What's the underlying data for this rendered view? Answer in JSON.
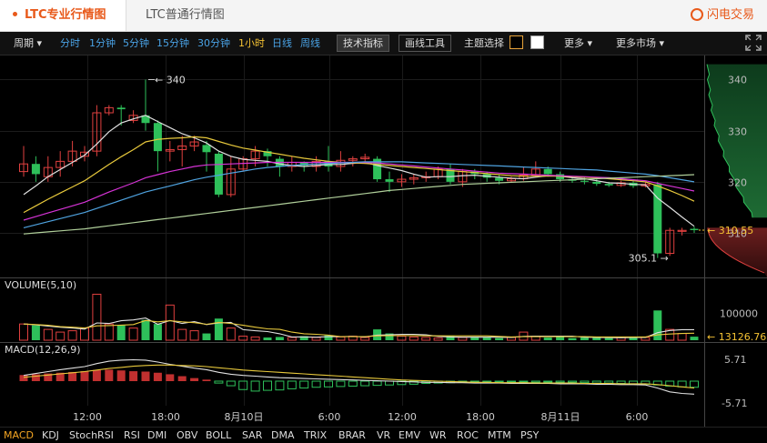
{
  "tabs": {
    "pro": "LTC专业行情图",
    "normal": "LTC普通行情图"
  },
  "brand": {
    "name": "闪电交易",
    "icon": "lightning-logo-icon"
  },
  "toolbar": {
    "period": "周期",
    "intervals": [
      "分时",
      "1分钟",
      "5分钟",
      "15分钟",
      "30分钟",
      "1小时",
      "日线",
      "周线"
    ],
    "active_interval": "1小时",
    "indicators_btn": "技术指标",
    "draw_tools_btn": "画线工具",
    "theme_label": "主题选择",
    "theme_colors": [
      "#000000",
      "#ffffff"
    ],
    "more": "更多",
    "more_markets": "更多市场",
    "fullscreen_icon": "fullscreen-icon"
  },
  "chart_data": [
    {
      "type": "candlestick",
      "panel": "price",
      "price_axis_ticks": [
        340,
        330,
        320,
        310
      ],
      "ylim": [
        302,
        344
      ],
      "last_price_label": "310.55",
      "last_price": 310.55,
      "max_annotation": "340",
      "max_price": 340,
      "min_annotation": "305.1",
      "min_price": 305.1,
      "x_labels": [
        "12:00",
        "18:00",
        "8月10日",
        "6:00",
        "12:00",
        "18:00",
        "8月11日",
        "6:00"
      ],
      "candles": [
        {
          "o": 322,
          "c": 323.5,
          "h": 327,
          "l": 321
        },
        {
          "o": 323.5,
          "c": 321.5,
          "h": 325,
          "l": 320
        },
        {
          "o": 321,
          "c": 322.8,
          "h": 325,
          "l": 320
        },
        {
          "o": 322.8,
          "c": 324,
          "h": 326,
          "l": 321
        },
        {
          "o": 324,
          "c": 326,
          "h": 328,
          "l": 323
        },
        {
          "o": 325,
          "c": 325.8,
          "h": 327,
          "l": 324
        },
        {
          "o": 326,
          "c": 333.5,
          "h": 335,
          "l": 325
        },
        {
          "o": 333.5,
          "c": 334.5,
          "h": 335,
          "l": 333
        },
        {
          "o": 334.5,
          "c": 334.2,
          "h": 335,
          "l": 331
        },
        {
          "o": 332,
          "c": 333,
          "h": 334,
          "l": 331.5
        },
        {
          "o": 333,
          "c": 331.5,
          "h": 340,
          "l": 330
        },
        {
          "o": 331.5,
          "c": 326,
          "h": 332,
          "l": 322
        },
        {
          "o": 326,
          "c": 326.3,
          "h": 328,
          "l": 324
        },
        {
          "o": 326.3,
          "c": 327,
          "h": 329,
          "l": 323
        },
        {
          "o": 327,
          "c": 327.8,
          "h": 329,
          "l": 326
        },
        {
          "o": 327.2,
          "c": 325.8,
          "h": 328,
          "l": 322
        },
        {
          "o": 325.5,
          "c": 317.5,
          "h": 326,
          "l": 317
        },
        {
          "o": 317.5,
          "c": 322.5,
          "h": 325,
          "l": 317
        },
        {
          "o": 322.5,
          "c": 324.5,
          "h": 325,
          "l": 322
        },
        {
          "o": 324.5,
          "c": 326,
          "h": 327,
          "l": 323
        },
        {
          "o": 326,
          "c": 325,
          "h": 326.5,
          "l": 323
        },
        {
          "o": 324.5,
          "c": 323,
          "h": 325,
          "l": 321
        },
        {
          "o": 323,
          "c": 323.8,
          "h": 325,
          "l": 322
        },
        {
          "o": 323.8,
          "c": 323.2,
          "h": 324,
          "l": 322
        },
        {
          "o": 323,
          "c": 324,
          "h": 325,
          "l": 322
        },
        {
          "o": 324,
          "c": 323,
          "h": 327,
          "l": 322
        },
        {
          "o": 323,
          "c": 324.2,
          "h": 326,
          "l": 322
        },
        {
          "o": 324.2,
          "c": 324.5,
          "h": 325,
          "l": 323
        },
        {
          "o": 324.5,
          "c": 324.8,
          "h": 325.5,
          "l": 323.5
        },
        {
          "o": 324.5,
          "c": 320.5,
          "h": 325,
          "l": 320
        },
        {
          "o": 320.5,
          "c": 320,
          "h": 322,
          "l": 318
        },
        {
          "o": 320,
          "c": 320.5,
          "h": 321.5,
          "l": 319
        },
        {
          "o": 320.5,
          "c": 320.8,
          "h": 321.5,
          "l": 319.5
        },
        {
          "o": 320.8,
          "c": 321,
          "h": 322,
          "l": 320
        },
        {
          "o": 321,
          "c": 322.5,
          "h": 323,
          "l": 320.5
        },
        {
          "o": 322.5,
          "c": 320,
          "h": 323.5,
          "l": 319.5
        },
        {
          "o": 320,
          "c": 322,
          "h": 322.5,
          "l": 319
        },
        {
          "o": 322,
          "c": 321.5,
          "h": 322.5,
          "l": 320.5
        },
        {
          "o": 321.5,
          "c": 320.8,
          "h": 322,
          "l": 320
        },
        {
          "o": 320.8,
          "c": 320.2,
          "h": 321.5,
          "l": 319.5
        },
        {
          "o": 320.2,
          "c": 320.6,
          "h": 321,
          "l": 319.8
        },
        {
          "o": 320.6,
          "c": 321.3,
          "h": 323,
          "l": 320.2
        },
        {
          "o": 321.3,
          "c": 322.5,
          "h": 324,
          "l": 321
        },
        {
          "o": 322.5,
          "c": 321.5,
          "h": 323,
          "l": 321
        },
        {
          "o": 321.5,
          "c": 320.5,
          "h": 322,
          "l": 320
        },
        {
          "o": 320.5,
          "c": 320.2,
          "h": 321,
          "l": 319.8
        },
        {
          "o": 320.2,
          "c": 320,
          "h": 320.8,
          "l": 319.5
        },
        {
          "o": 320,
          "c": 319.6,
          "h": 320.5,
          "l": 319.2
        },
        {
          "o": 319.6,
          "c": 319.3,
          "h": 320,
          "l": 319
        },
        {
          "o": 319.3,
          "c": 319.8,
          "h": 320.2,
          "l": 319
        },
        {
          "o": 319.8,
          "c": 319.2,
          "h": 320.3,
          "l": 318.8
        },
        {
          "o": 319.2,
          "c": 319.5,
          "h": 320,
          "l": 318.9
        },
        {
          "o": 319.5,
          "c": 306,
          "h": 320,
          "l": 305.1
        },
        {
          "o": 306,
          "c": 310.5,
          "h": 311,
          "l": 305.5
        },
        {
          "o": 310.3,
          "c": 310.5,
          "h": 311,
          "l": 309.5
        },
        {
          "o": 310.8,
          "c": 310.55,
          "h": 311.2,
          "l": 310
        }
      ],
      "ma_series": [
        {
          "color": "#e0e0e0",
          "values": [
            317.5,
            319.2,
            321,
            322.4,
            323.8,
            325.2,
            327.4,
            329.8,
            331.5,
            332.3,
            333,
            331.8,
            330.6,
            329.4,
            328.6,
            327.6,
            326,
            325,
            324.4,
            324.2,
            324,
            323.5,
            323.2,
            323,
            323.2,
            323.4,
            323.4,
            323.6,
            323.8,
            323.2,
            322.7,
            322.2,
            321.5,
            320.9,
            321,
            321,
            321.2,
            321.3,
            321.1,
            320.9,
            320.7,
            320.6,
            320.9,
            321.2,
            321.1,
            320.8,
            320.6,
            320.2,
            319.8,
            319.7,
            319.5,
            319.4,
            316.8,
            315,
            313.1,
            311.3
          ]
        },
        {
          "color": "#e8c93c",
          "values": [
            314,
            315.3,
            316.6,
            317.8,
            319,
            320.2,
            321.8,
            323.4,
            324.9,
            326.3,
            327.8,
            328.3,
            328.5,
            328.6,
            328.8,
            328.6,
            327.9,
            327.2,
            326.6,
            326.2,
            325.8,
            325.4,
            325,
            324.6,
            324.3,
            324,
            323.8,
            323.7,
            323.6,
            323.4,
            323.2,
            323,
            322.8,
            322.6,
            322.4,
            322.2,
            322,
            321.8,
            321.6,
            321.4,
            321.2,
            321.1,
            321.1,
            321.1,
            321.1,
            321,
            320.9,
            320.8,
            320.6,
            320.4,
            320.2,
            320,
            319.2,
            318.3,
            317.3,
            316.2
          ]
        },
        {
          "color": "#d633d6",
          "values": [
            312.5,
            313.2,
            313.9,
            314.6,
            315.3,
            316,
            317,
            318,
            318.9,
            319.8,
            320.8,
            321.4,
            322,
            322.5,
            323,
            323.3,
            323.4,
            323.5,
            323.6,
            323.7,
            323.8,
            323.8,
            323.8,
            323.8,
            323.8,
            323.8,
            323.8,
            323.8,
            323.8,
            323.7,
            323.5,
            323.3,
            323.1,
            322.9,
            322.7,
            322.5,
            322.3,
            322.1,
            321.9,
            321.7,
            321.6,
            321.5,
            321.4,
            321.3,
            321.2,
            321.1,
            321,
            320.9,
            320.8,
            320.6,
            320.4,
            320.2,
            319.7,
            319.2,
            318.7,
            318.2
          ]
        },
        {
          "color": "#4fa3e0",
          "values": [
            311,
            311.6,
            312.2,
            312.8,
            313.4,
            314,
            314.8,
            315.6,
            316.4,
            317.2,
            318,
            318.6,
            319.2,
            319.8,
            320.4,
            320.9,
            321.3,
            321.7,
            322.1,
            322.5,
            322.8,
            323,
            323.2,
            323.4,
            323.5,
            323.6,
            323.7,
            323.8,
            323.9,
            323.9,
            323.9,
            323.9,
            323.8,
            323.7,
            323.6,
            323.5,
            323.4,
            323.3,
            323.2,
            323.1,
            323,
            322.9,
            322.8,
            322.7,
            322.6,
            322.5,
            322.4,
            322.3,
            322.1,
            321.9,
            321.7,
            321.5,
            321.2,
            320.8,
            320.4,
            320
          ]
        },
        {
          "color": "#b0cf9a",
          "values": [
            309.8,
            310,
            310.2,
            310.4,
            310.6,
            310.8,
            311.1,
            311.4,
            311.7,
            312,
            312.3,
            312.6,
            312.9,
            313.2,
            313.5,
            313.8,
            314.1,
            314.4,
            314.7,
            315,
            315.3,
            315.6,
            315.9,
            316.2,
            316.5,
            316.8,
            317.1,
            317.4,
            317.7,
            318,
            318.3,
            318.5,
            318.7,
            318.9,
            319.1,
            319.3,
            319.5,
            319.6,
            319.7,
            319.8,
            319.9,
            320,
            320.1,
            320.2,
            320.3,
            320.4,
            320.5,
            320.6,
            320.7,
            320.8,
            320.9,
            321,
            321.1,
            321.2,
            321.3,
            321.4
          ]
        }
      ]
    },
    {
      "type": "bar",
      "panel": "volume",
      "title": "VOLUME(5,10)",
      "axis_tick": "100000",
      "axis_tick_value": 100000,
      "last_label": "13126.76",
      "last_value": 13126.76,
      "ylim": [
        0,
        185000
      ],
      "values": [
        60000,
        55000,
        40000,
        30000,
        35000,
        45000,
        170000,
        60000,
        55000,
        45000,
        75000,
        60000,
        130000,
        40000,
        35000,
        25000,
        80000,
        45000,
        15000,
        12000,
        10000,
        12000,
        10000,
        15000,
        10000,
        18000,
        12000,
        15000,
        10000,
        40000,
        25000,
        15000,
        12000,
        10000,
        8000,
        15000,
        10000,
        12000,
        10000,
        8000,
        10000,
        30000,
        15000,
        10000,
        12000,
        8000,
        10000,
        10000,
        8000,
        10000,
        12000,
        10000,
        110000,
        40000,
        25000,
        13126.76
      ],
      "ma_series": [
        {
          "color": "#e0e0e0",
          "values": [
            60000,
            57000,
            52000,
            48000,
            45000,
            41000,
            64000,
            62000,
            72000,
            75000,
            82000,
            59000,
            73000,
            62000,
            69000,
            58000,
            64000,
            66000,
            39000,
            35000,
            32000,
            24000,
            12000,
            12000,
            11000,
            13000,
            13000,
            14000,
            12000,
            19000,
            20000,
            22000,
            22000,
            20000,
            14000,
            12000,
            11000,
            11000,
            11000,
            11000,
            10000,
            14000,
            15000,
            15000,
            15000,
            15000,
            11000,
            10000,
            9600,
            9200,
            10000,
            10000,
            28000,
            36000,
            39000,
            39000
          ]
        },
        {
          "color": "#e8c93c",
          "values": [
            60000,
            58000,
            55000,
            50000,
            48000,
            45000,
            53000,
            54000,
            56000,
            58000,
            73000,
            68000,
            72000,
            68000,
            65000,
            59000,
            66000,
            62000,
            55000,
            48000,
            42000,
            40000,
            30000,
            24000,
            22000,
            19000,
            13000,
            13000,
            13000,
            16000,
            17000,
            17000,
            17000,
            16000,
            16000,
            16000,
            16000,
            16000,
            16000,
            14000,
            12000,
            13000,
            13000,
            13000,
            13000,
            13000,
            13000,
            12000,
            12000,
            12000,
            12000,
            12000,
            20000,
            23000,
            25000,
            26000
          ]
        }
      ]
    },
    {
      "type": "bar",
      "panel": "macd",
      "title": "MACD(12,26,9)",
      "axis_ticks": [
        "5.71",
        "-5.71"
      ],
      "ylim": [
        -5.71,
        5.71
      ],
      "hist": [
        1.6,
        1.8,
        2.0,
        2.2,
        2.4,
        2.6,
        2.9,
        3.0,
        2.8,
        2.6,
        2.5,
        2.2,
        1.8,
        1.3,
        0.8,
        0.4,
        -0.5,
        -1.2,
        -2.2,
        -2.6,
        -2.4,
        -2.3,
        -2.0,
        -1.8,
        -1.6,
        -1.5,
        -1.4,
        -1.3,
        -1.2,
        -1.1,
        -1.0,
        -0.9,
        -0.8,
        -0.6,
        -0.5,
        -0.4,
        -0.3,
        -0.2,
        -0.2,
        -0.1,
        -0.2,
        -0.2,
        -0.3,
        -0.2,
        -0.3,
        -0.3,
        -0.4,
        -0.5,
        -0.5,
        -0.6,
        -0.7,
        -0.8,
        -1.0,
        -1.3,
        -1.5,
        -1.6
      ],
      "dif": [
        1.5,
        2.0,
        2.5,
        3.0,
        3.4,
        3.8,
        4.6,
        5.2,
        5.5,
        5.6,
        5.5,
        5.0,
        4.4,
        3.9,
        3.4,
        3.0,
        2.3,
        1.8,
        1.5,
        1.3,
        1.1,
        0.9,
        0.8,
        0.7,
        0.6,
        0.5,
        0.4,
        0.3,
        0.2,
        0.1,
        0.0,
        -0.1,
        -0.2,
        -0.3,
        -0.3,
        -0.4,
        -0.4,
        -0.5,
        -0.5,
        -0.5,
        -0.6,
        -0.6,
        -0.6,
        -0.6,
        -0.7,
        -0.7,
        -0.7,
        -0.8,
        -0.8,
        -0.9,
        -0.9,
        -1.0,
        -1.8,
        -2.8,
        -3.2,
        -3.4
      ],
      "dea": [
        1.0,
        1.3,
        1.6,
        1.9,
        2.2,
        2.5,
        2.9,
        3.3,
        3.6,
        3.9,
        4.1,
        4.2,
        4.2,
        4.1,
        4.0,
        3.8,
        3.5,
        3.2,
        2.9,
        2.7,
        2.5,
        2.3,
        2.1,
        1.9,
        1.7,
        1.5,
        1.3,
        1.1,
        0.9,
        0.7,
        0.5,
        0.3,
        0.2,
        0.1,
        0.0,
        -0.1,
        -0.2,
        -0.3,
        -0.3,
        -0.4,
        -0.4,
        -0.4,
        -0.5,
        -0.5,
        -0.5,
        -0.5,
        -0.6,
        -0.6,
        -0.6,
        -0.7,
        -0.7,
        -0.7,
        -0.9,
        -1.2,
        -1.5,
        -1.8
      ]
    }
  ],
  "indicator_bar": [
    "MACD",
    "KDJ",
    "StochRSI",
    "RSI",
    "DMI",
    "OBV",
    "BOLL",
    "SAR",
    "DMA",
    "TRIX",
    "BRAR",
    "VR",
    "EMV",
    "WR",
    "ROC",
    "MTM",
    "PSY"
  ],
  "active_indicator": "MACD",
  "colors": {
    "up": "#e0403f",
    "down": "#2ec05a",
    "accent": "#e8591a",
    "price_label": "#f5c233"
  }
}
